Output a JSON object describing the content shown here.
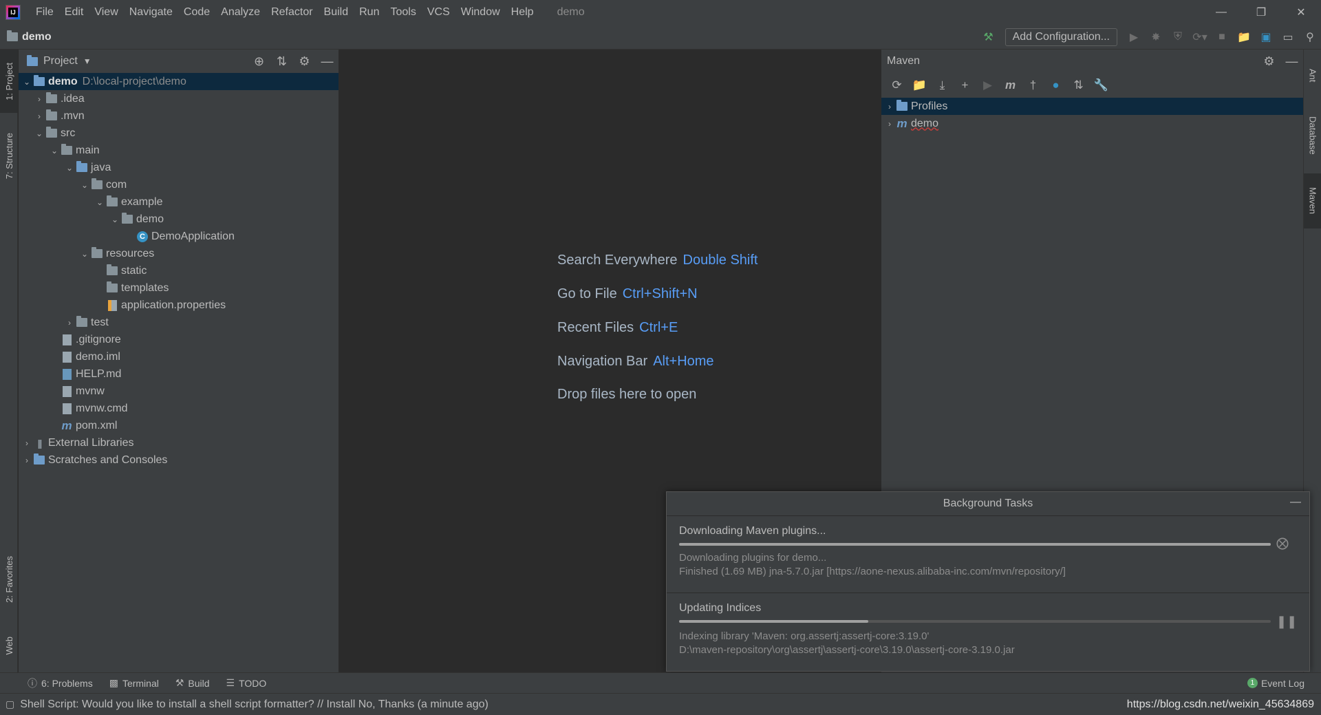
{
  "menubar": {
    "items": [
      "File",
      "Edit",
      "View",
      "Navigate",
      "Code",
      "Analyze",
      "Refactor",
      "Build",
      "Run",
      "Tools",
      "VCS",
      "Window",
      "Help"
    ],
    "project_title": "demo",
    "logo_text": "IJ"
  },
  "navbar": {
    "breadcrumb": "demo",
    "add_configuration": "Add Configuration..."
  },
  "left_strip": {
    "tabs": [
      "1: Project",
      "7: Structure",
      "2: Favorites",
      "Web"
    ]
  },
  "project_panel": {
    "title": "Project",
    "tree": [
      {
        "label": "demo",
        "path": "D:\\local-project\\demo"
      },
      {
        "label": ".idea"
      },
      {
        "label": ".mvn"
      },
      {
        "label": "src"
      },
      {
        "label": "main"
      },
      {
        "label": "java"
      },
      {
        "label": "com"
      },
      {
        "label": "example"
      },
      {
        "label": "demo"
      },
      {
        "label": "DemoApplication"
      },
      {
        "label": "resources"
      },
      {
        "label": "static"
      },
      {
        "label": "templates"
      },
      {
        "label": "application.properties"
      },
      {
        "label": "test"
      },
      {
        "label": ".gitignore"
      },
      {
        "label": "demo.iml"
      },
      {
        "label": "HELP.md"
      },
      {
        "label": "mvnw"
      },
      {
        "label": "mvnw.cmd"
      },
      {
        "label": "pom.xml"
      },
      {
        "label": "External Libraries"
      },
      {
        "label": "Scratches and Consoles"
      }
    ]
  },
  "editor": {
    "hints": [
      {
        "label": "Search Everywhere",
        "key": "Double Shift"
      },
      {
        "label": "Go to File",
        "key": "Ctrl+Shift+N"
      },
      {
        "label": "Recent Files",
        "key": "Ctrl+E"
      },
      {
        "label": "Navigation Bar",
        "key": "Alt+Home"
      },
      {
        "label": "Drop files here to open",
        "key": ""
      }
    ]
  },
  "maven_panel": {
    "title": "Maven",
    "tree": [
      {
        "label": "Profiles"
      },
      {
        "label": "demo"
      }
    ]
  },
  "right_strip": {
    "tabs": [
      "Ant",
      "Database",
      "Maven"
    ]
  },
  "bg_tasks": {
    "title": "Background Tasks",
    "tasks": [
      {
        "title": "Downloading Maven plugins...",
        "progress": 1.0,
        "line1": "Downloading plugins for demo...",
        "line2": "Finished (1.69 MB) jna-5.7.0.jar [https://aone-nexus.alibaba-inc.com/mvn/repository/]"
      },
      {
        "title": "Updating Indices",
        "progress": 0.32,
        "line1": "Indexing library 'Maven: org.assertj:assertj-core:3.19.0'",
        "line2": "D:\\maven-repository\\org\\assertj\\assertj-core\\3.19.0\\assertj-core-3.19.0.jar"
      }
    ]
  },
  "bottom_tools": {
    "problems": "6: Problems",
    "terminal": "Terminal",
    "build": "Build",
    "todo": "TODO",
    "event_log": "Event Log",
    "event_count": "1"
  },
  "statusbar": {
    "message": "Shell Script: Would you like to install a shell script formatter? // Install    No, Thanks (a minute ago)",
    "right_text": "https://blog.csdn.net/weixin_45634869"
  },
  "colors": {
    "background": "#2b2b2b",
    "panel": "#3c3f41",
    "selection": "#0d293e",
    "shortcut_key": "#589df6",
    "class_icon": "#3592c4"
  }
}
